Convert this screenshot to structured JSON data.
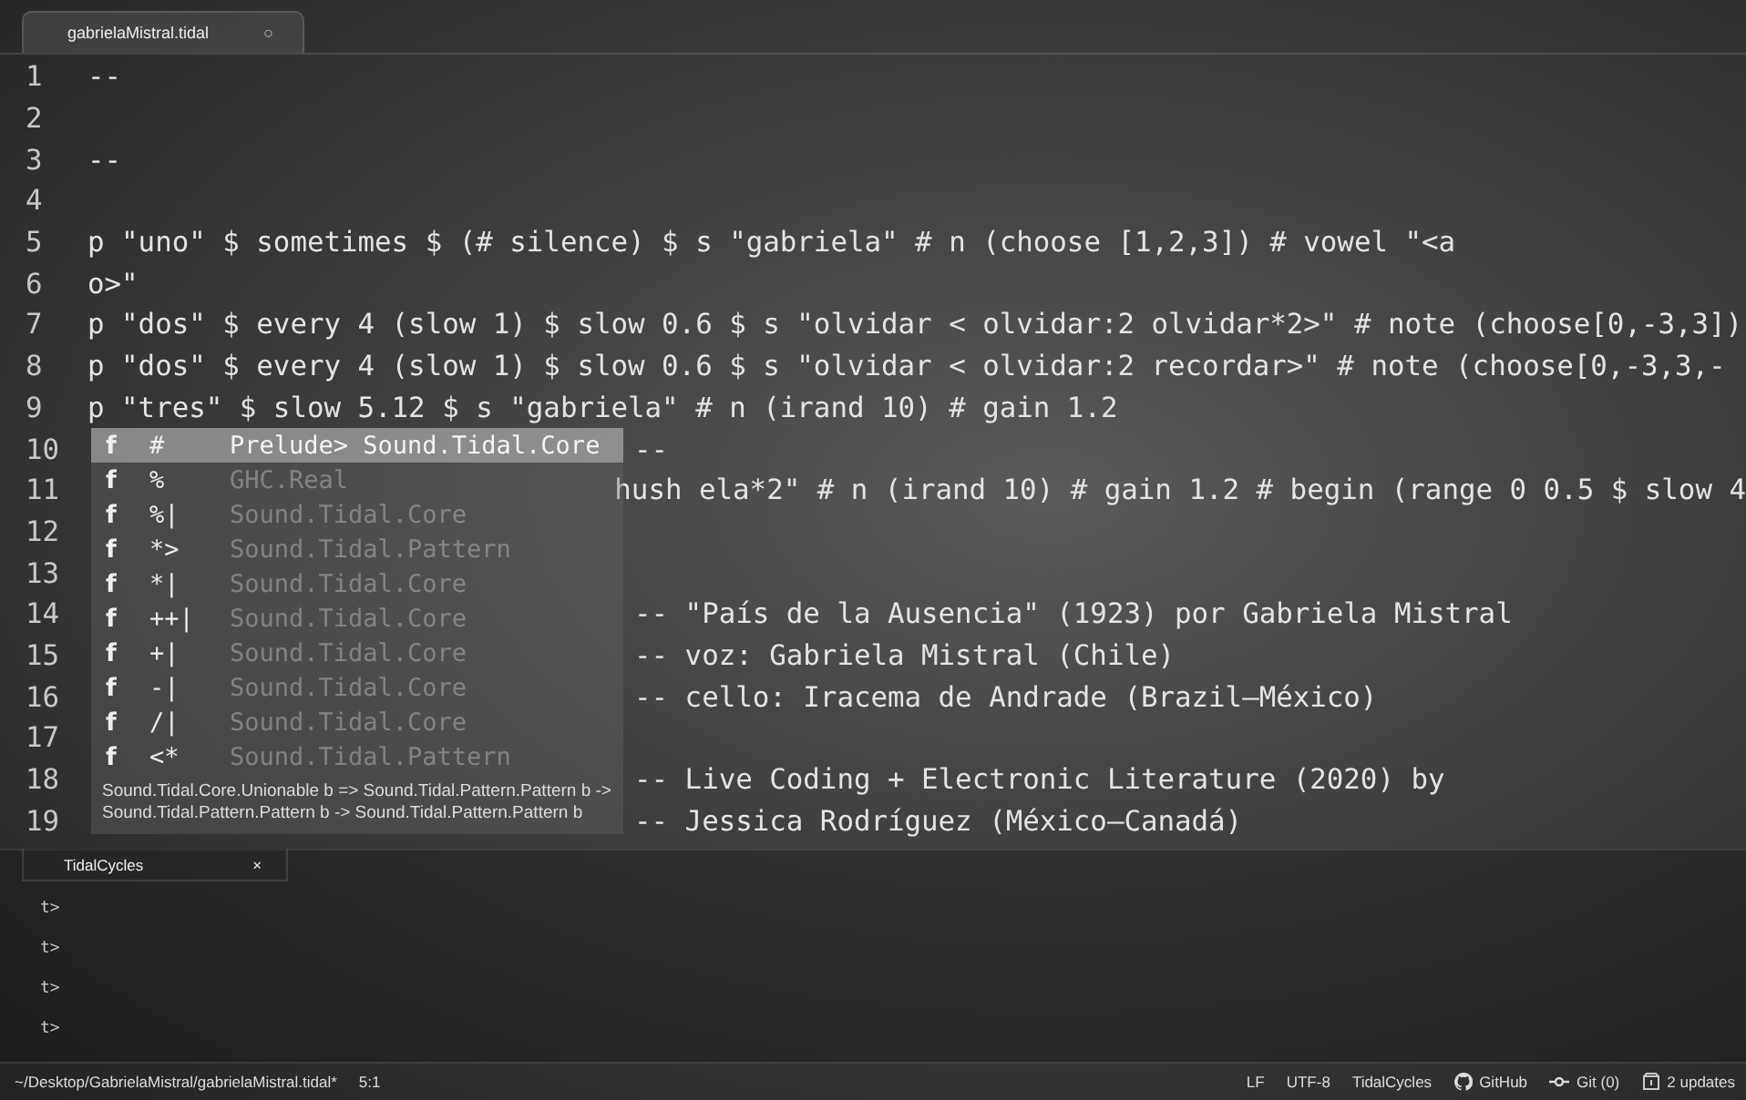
{
  "tab": {
    "title": "gabrielaMistral.tidal",
    "modified_mark": "○"
  },
  "editor": {
    "lines": [
      {
        "number": "1",
        "text": "--"
      },
      {
        "number": "2"
      },
      {
        "number": "3",
        "text": "--"
      },
      {
        "number": "4"
      },
      {
        "number": "5",
        "text": "p \"uno\" $ sometimes $ (# silence) $ s \"gabriela\" # n (choose [1,2,3]) # vowel \"<a"
      },
      {
        "number": "6",
        "text": "o>\""
      },
      {
        "number": "7",
        "text": "p \"dos\" $ every 4 (slow 1) $ slow 0.6 $ s \"olvidar < olvidar:2 olvidar*2>\" # note (choose[0,-3,3])"
      },
      {
        "number": "8",
        "text": "p \"dos\" $ every 4 (slow 1) $ slow 0.6 $ s \"olvidar < olvidar:2 recordar>\" # note (choose[0,-3,3,-"
      },
      {
        "number": "9",
        "text": "p \"tres\" $ slow 5.12 $ s \"gabriela\" # n (irand 10) # gain 1.2"
      },
      {
        "number": "10",
        "text": "--"
      },
      {
        "number": "11",
        "text": "hush",
        "tail": "ela*2\" # n (irand 10) # gain 1.2 # begin (range 0 0.5 $ slow 4"
      },
      {
        "number": "12"
      },
      {
        "number": "13"
      },
      {
        "number": "14",
        "text": "-- \"País de la Ausencia\" (1923) por Gabriela Mistral"
      },
      {
        "number": "15",
        "text": "-- voz: Gabriela Mistral (Chile)"
      },
      {
        "number": "16",
        "text": "-- cello: Iracema de Andrade (Brazil–México)"
      },
      {
        "number": "17"
      },
      {
        "number": "18",
        "text": "-- Live Coding + Electronic Literature (2020) by"
      },
      {
        "number": "19",
        "text": "-- Jessica Rodríguez (México–Canadá)"
      }
    ]
  },
  "autocomplete": {
    "items": [
      {
        "type": "f",
        "label": "#",
        "detail": "Prelude> Sound.Tidal.Core",
        "selected": true
      },
      {
        "type": "f",
        "label": "%",
        "detail": "GHC.Real",
        "selected": false
      },
      {
        "type": "f",
        "label": "%|",
        "detail": "Sound.Tidal.Core",
        "selected": false
      },
      {
        "type": "f",
        "label": "*>",
        "detail": "Sound.Tidal.Pattern",
        "selected": false
      },
      {
        "type": "f",
        "label": "*|",
        "detail": "Sound.Tidal.Core",
        "selected": false
      },
      {
        "type": "f",
        "label": "++|",
        "detail": "Sound.Tidal.Core",
        "selected": false
      },
      {
        "type": "f",
        "label": "+|",
        "detail": "Sound.Tidal.Core",
        "selected": false
      },
      {
        "type": "f",
        "label": "-|",
        "detail": "Sound.Tidal.Core",
        "selected": false
      },
      {
        "type": "f",
        "label": "/|",
        "detail": "Sound.Tidal.Core",
        "selected": false
      },
      {
        "type": "f",
        "label": "<*",
        "detail": "Sound.Tidal.Pattern",
        "selected": false
      }
    ],
    "description": "Sound.Tidal.Core.Unionable b => Sound.Tidal.Pattern.Pattern b -> Sound.Tidal.Pattern.Pattern b -> Sound.Tidal.Pattern.Pattern b"
  },
  "panel": {
    "tab": {
      "title": "TidalCycles",
      "close": "×"
    },
    "prompts": [
      "t>",
      "t>",
      "t>",
      "t>"
    ]
  },
  "status_bar": {
    "path": "~/Desktop/GabrielaMistral/gabrielaMistral.tidal*",
    "cursor": "5:1",
    "items": [
      {
        "kind": "plain",
        "label": "LF"
      },
      {
        "kind": "plain",
        "label": "UTF-8"
      },
      {
        "kind": "plain",
        "label": "TidalCycles"
      },
      {
        "kind": "github",
        "label": "GitHub"
      },
      {
        "kind": "git",
        "label": "Git (0)"
      },
      {
        "kind": "updates",
        "label": "2 updates"
      }
    ]
  }
}
